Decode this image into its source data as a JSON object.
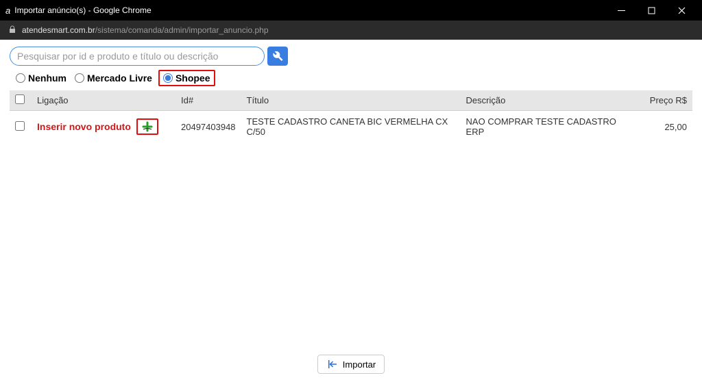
{
  "window": {
    "title": "Importar anúncio(s) - Google Chrome"
  },
  "address": {
    "host": "atendesmart.com.br",
    "path": "/sistema/comanda/admin/importar_anuncio.php"
  },
  "search": {
    "placeholder": "Pesquisar por id e produto e título ou descrição"
  },
  "filters": {
    "nenhum": "Nenhum",
    "mercado_livre": "Mercado Livre",
    "shopee": "Shopee",
    "selected": "shopee"
  },
  "table": {
    "headers": {
      "ligacao": "Ligação",
      "id": "Id#",
      "titulo": "Título",
      "descricao": "Descrição",
      "preco": "Preço R$"
    },
    "rows": [
      {
        "ligacao_text": "Inserir novo produto",
        "id": "20497403948",
        "titulo": "TESTE CADASTRO CANETA BIC VERMELHA CX C/50",
        "descricao": "NAO COMPRAR TESTE CADASTRO ERP",
        "preco": "25,00"
      }
    ]
  },
  "footer": {
    "import_label": "Importar"
  }
}
